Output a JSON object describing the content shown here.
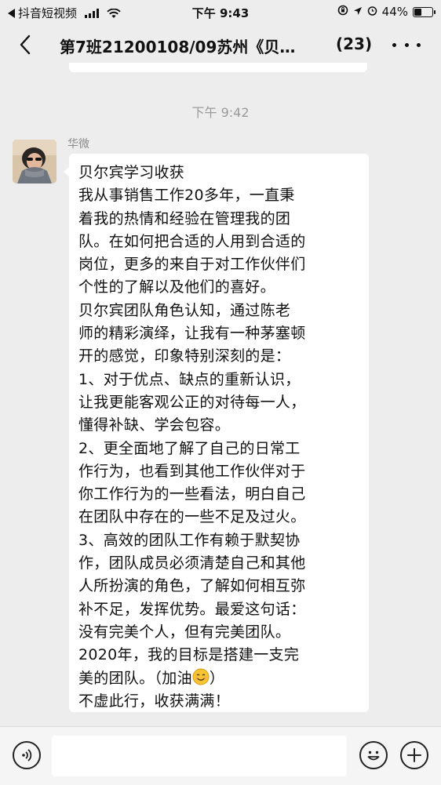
{
  "status_bar": {
    "back_app": "抖音短视频",
    "time": "下午 9:43",
    "battery": "44%",
    "battery_level": 0.44
  },
  "nav": {
    "title": "第7班21200108/09苏州《贝…",
    "member_count": "(23)"
  },
  "chat": {
    "timestamp": "下午 9:42",
    "sender": "华微",
    "message_lines": [
      "贝尔宾学习收获",
      "  我从事销售工作20多年，一直秉",
      "着我的热情和经验在管理我的团",
      "队。在如何把合适的人用到合适的",
      "岗位，更多的来自于对工作伙伴们",
      "个性的了解以及他们的喜好。",
      "  贝尔宾团队角色认知，通过陈老",
      "师的精彩演绎，让我有一种茅塞顿",
      "开的感觉，印象特别深刻的是：",
      "1、对于优点、缺点的重新认识，",
      "让我更能客观公正的对待每一人，",
      "懂得补缺、学会包容。",
      "2、更全面地了解了自己的日常工",
      "作行为，也看到其他工作伙伴对于",
      "你工作行为的一些看法，明白自己",
      "在团队中存在的一些不足及过火。",
      "3、高效的团队工作有赖于默契协",
      "作，团队成员必须清楚自己和其他",
      "人所扮演的角色，了解如何相互弥",
      "补不足，发挥优势。最爱这句话：",
      "没有完美个人，但有完美团队。",
      "  2020年，我的目标是搭建一支完",
      "美的团队。（加油",
      "不虚此行，收获满满！"
    ],
    "emoji_tail": "）"
  },
  "input_bar": {
    "placeholder": ""
  },
  "icons": {
    "back": "chevron-left-icon",
    "more": "more-dots-icon",
    "voice": "voice-icon",
    "emoji": "emoji-icon",
    "plus": "plus-icon",
    "smile": "smiling-face-emoji"
  },
  "colors": {
    "background": "#ededed",
    "bubble": "#ffffff",
    "timestamp": "#9a9a9a",
    "sender": "#8a8a8a"
  }
}
